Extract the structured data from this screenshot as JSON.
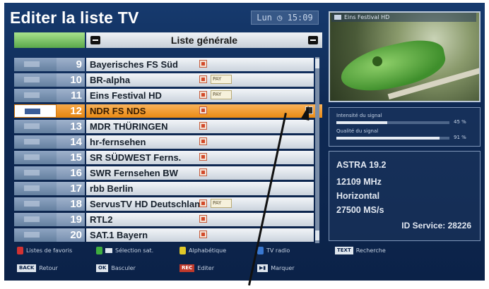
{
  "header": {
    "title": "Editer la liste TV",
    "clock": "Lun ◷ 15:09"
  },
  "list": {
    "title": "Liste générale",
    "channels": [
      {
        "number": "9",
        "name": "Bayerisches FS Süd",
        "badge": false
      },
      {
        "number": "10",
        "name": "BR-alpha",
        "badge": true
      },
      {
        "number": "11",
        "name": "Eins Festival HD",
        "badge": true
      },
      {
        "number": "12",
        "name": "NDR FS NDS",
        "badge": false,
        "selected": true
      },
      {
        "number": "13",
        "name": "MDR THÜRINGEN",
        "badge": false
      },
      {
        "number": "14",
        "name": "hr-fernsehen",
        "badge": false
      },
      {
        "number": "15",
        "name": "SR SÜDWEST Ferns.",
        "badge": false
      },
      {
        "number": "16",
        "name": "SWR Fernsehen BW",
        "badge": false
      },
      {
        "number": "17",
        "name": "rbb Berlin",
        "badge": false,
        "noflag": true
      },
      {
        "number": "18",
        "name": "ServusTV HD Deutschland",
        "badge": true
      },
      {
        "number": "19",
        "name": "RTL2",
        "badge": false
      },
      {
        "number": "20",
        "name": "SAT.1 Bayern",
        "badge": false
      }
    ],
    "badge_text": "PAY"
  },
  "preview": {
    "label": "Eins Festival HD"
  },
  "signal": {
    "intensity_label": "Intensité du signal",
    "intensity_value": "45 %",
    "intensity_level": 0.45,
    "quality_label": "Qualité du signal",
    "quality_value": "91 %",
    "quality_level": 0.91
  },
  "info": {
    "satellite": "ASTRA 19.2",
    "frequency": "12109 MHz",
    "polarization": "Horizontal",
    "symbol_rate": "27500 MS/s",
    "service_id": "ID Service: 28226"
  },
  "legend": {
    "red": "Listes de favoris",
    "green": "Sélection sat.",
    "yellow": "Alphabétique",
    "blue": "TV radio",
    "text_key": "TEXT",
    "text_label": "Recherche",
    "back_key": "BACK",
    "back_label": "Retour",
    "ok_key": "OK",
    "ok_label": "Basculer",
    "rec_key": "REC",
    "rec_label": "Editer",
    "play_key": "▶▮",
    "play_label": "Marquer"
  },
  "colors": {
    "selected": "#ea8b14",
    "background": "#0f2a55",
    "red": "#d23232",
    "green": "#3fae3f",
    "yellow": "#e0c828",
    "blue": "#3a78d0"
  }
}
